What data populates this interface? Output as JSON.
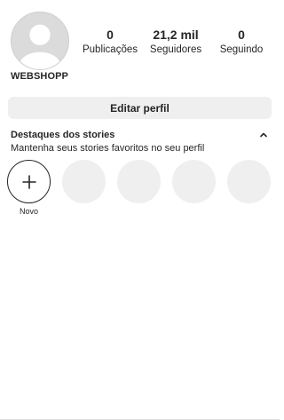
{
  "profile": {
    "username": "WEBSHOPP",
    "avatar_icon": "default-avatar-icon"
  },
  "stats": [
    {
      "value": "0",
      "label": "Publicações"
    },
    {
      "value": "21,2 mil",
      "label": "Seguidores"
    },
    {
      "value": "0",
      "label": "Seguindo"
    }
  ],
  "actions": {
    "edit_profile_label": "Editar perfil"
  },
  "highlights": {
    "title": "Destaques dos stories",
    "subtitle": "Mantenha seus stories favoritos no seu perfil",
    "collapse_icon": "chevron-up-icon",
    "new_label": "Novo",
    "new_icon": "plus-icon"
  },
  "colors": {
    "text": "#262626",
    "button_bg": "#efefef",
    "placeholder": "#efefef",
    "avatar_bg": "#dbdbdb"
  }
}
